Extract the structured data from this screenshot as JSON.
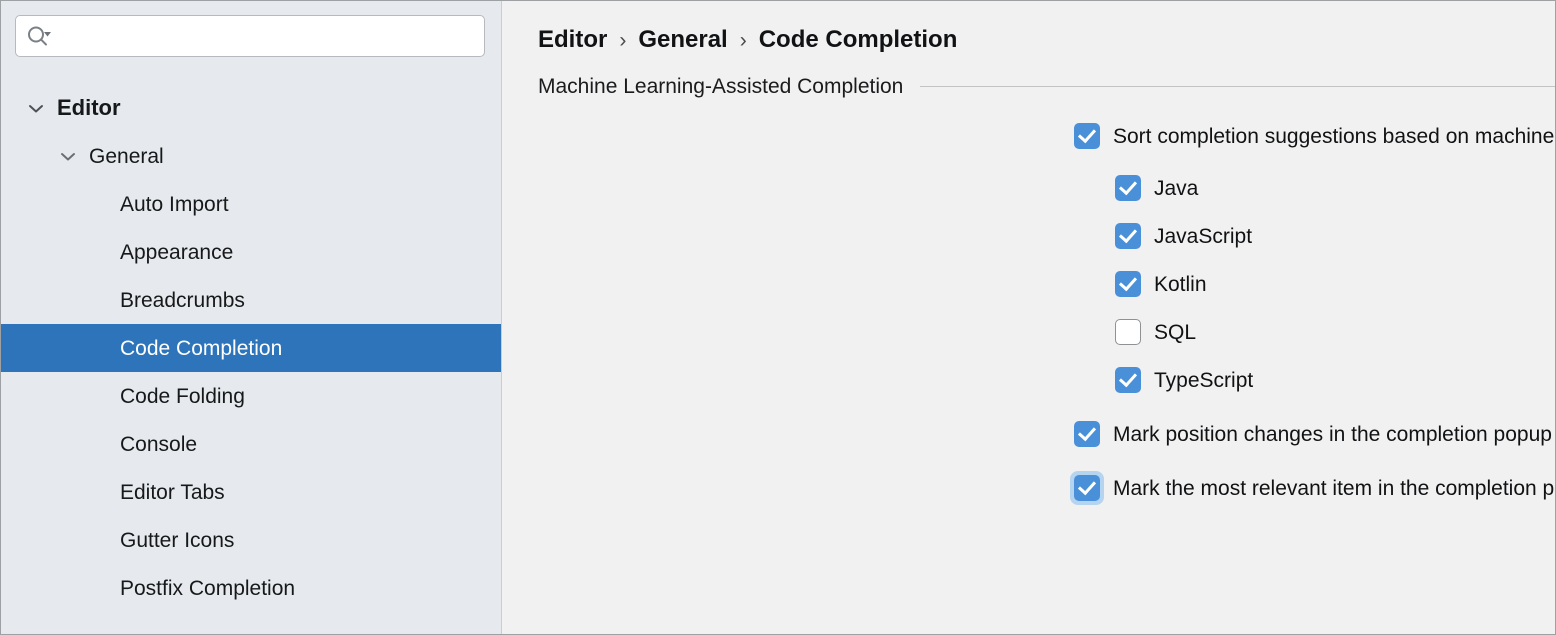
{
  "window": {
    "colors": {
      "sidebar_bg": "#e6eaee",
      "content_bg": "#f1f1f1",
      "selection_blue": "#2d74bb",
      "checkbox_blue": "#4a90d9",
      "focus_ring": "#b5d4f0",
      "arrow_up_green": "#7cc17c",
      "arrow_down_red": "#e98b8b",
      "star_gray": "#a9b4bf",
      "divider": "#c3c3c3"
    }
  },
  "sidebar": {
    "search": {
      "icon": "search-icon",
      "dropdown_icon": "chevron-down-icon",
      "value": "",
      "placeholder": ""
    },
    "tree": [
      {
        "label": "Editor",
        "level": 0,
        "expanded": true,
        "chevron": "chevron-down-icon",
        "selected": false
      },
      {
        "label": "General",
        "level": 1,
        "expanded": true,
        "chevron": "chevron-down-icon",
        "selected": false
      },
      {
        "label": "Auto Import",
        "level": 2,
        "expanded": null,
        "chevron": null,
        "selected": false
      },
      {
        "label": "Appearance",
        "level": 2,
        "expanded": null,
        "chevron": null,
        "selected": false
      },
      {
        "label": "Breadcrumbs",
        "level": 2,
        "expanded": null,
        "chevron": null,
        "selected": false
      },
      {
        "label": "Code Completion",
        "level": 2,
        "expanded": null,
        "chevron": null,
        "selected": true
      },
      {
        "label": "Code Folding",
        "level": 2,
        "expanded": null,
        "chevron": null,
        "selected": false
      },
      {
        "label": "Console",
        "level": 2,
        "expanded": null,
        "chevron": null,
        "selected": false
      },
      {
        "label": "Editor Tabs",
        "level": 2,
        "expanded": null,
        "chevron": null,
        "selected": false
      },
      {
        "label": "Gutter Icons",
        "level": 2,
        "expanded": null,
        "chevron": null,
        "selected": false
      },
      {
        "label": "Postfix Completion",
        "level": 2,
        "expanded": null,
        "chevron": null,
        "selected": false
      }
    ]
  },
  "content": {
    "breadcrumb": {
      "items": [
        "Editor",
        "General",
        "Code Completion"
      ],
      "separator": "›"
    },
    "section": {
      "title": "Machine Learning-Assisted Completion"
    },
    "main_option": {
      "label": "Sort completion suggestions based on machine learning",
      "checked": true,
      "help_icon": "help-circle-icon"
    },
    "languages": [
      {
        "label": "Java",
        "checked": true
      },
      {
        "label": "JavaScript",
        "checked": true
      },
      {
        "label": "Kotlin",
        "checked": true
      },
      {
        "label": "SQL",
        "checked": false
      },
      {
        "label": "TypeScript",
        "checked": true
      }
    ],
    "options": [
      {
        "label": "Mark position changes in the completion popup",
        "checked": true,
        "focused": false,
        "trailing_icon": "up-down-arrows-icon"
      },
      {
        "label": "Mark the most relevant item in the completion popup",
        "checked": true,
        "focused": true,
        "trailing_icon": "star-icon"
      }
    ]
  }
}
